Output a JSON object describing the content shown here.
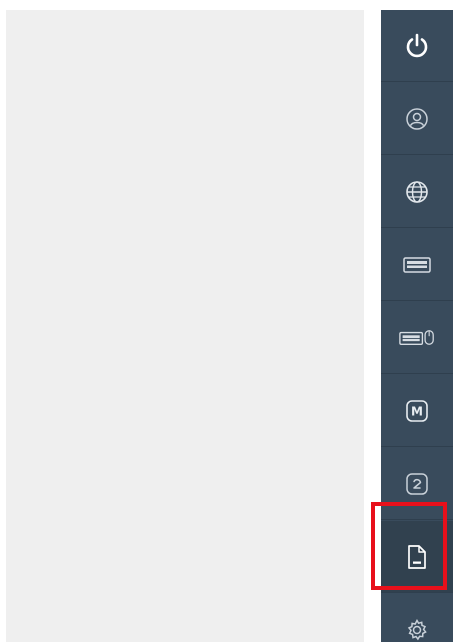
{
  "sidebar": {
    "background": "#394b5c",
    "items": [
      {
        "icon": "power-icon"
      },
      {
        "icon": "user-circle-icon"
      },
      {
        "icon": "globe-icon"
      },
      {
        "icon": "keyboard-icon"
      },
      {
        "icon": "keyboard-mouse-icon"
      },
      {
        "icon": "macro-icon",
        "icon_text": "M"
      },
      {
        "icon": "cycle-icon"
      },
      {
        "icon": "file-icon",
        "selected": true
      },
      {
        "icon": "gear-icon"
      }
    ]
  },
  "highlight": {
    "color": "#e8101b",
    "target": "file-icon"
  }
}
